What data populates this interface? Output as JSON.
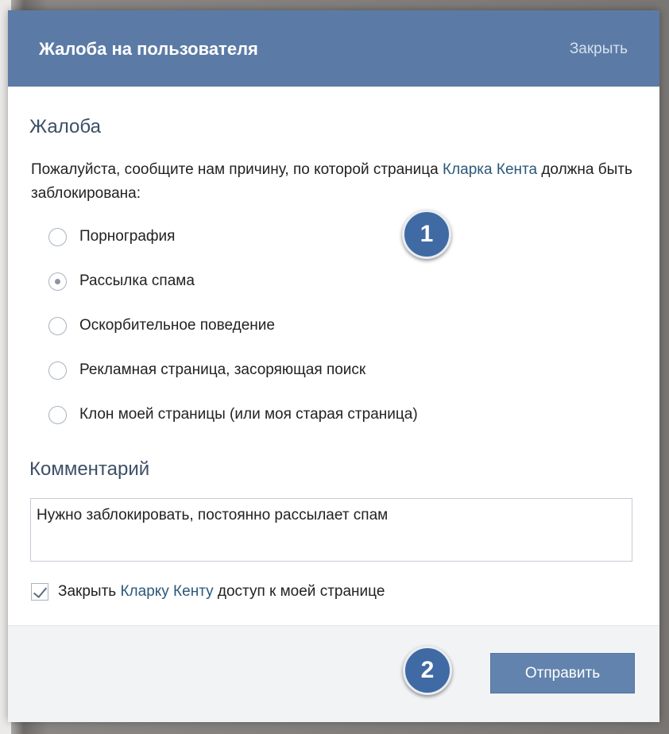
{
  "dialog": {
    "title": "Жалоба на пользователя",
    "close_label": "Закрыть"
  },
  "complaint": {
    "section_title": "Жалоба",
    "description_before": "Пожалуйста, сообщите нам причину, по которой страница ",
    "description_link": "Кларка Кента",
    "description_after": " должна быть заблокирована:",
    "options": [
      {
        "label": "Порнография",
        "checked": false
      },
      {
        "label": "Рассылка спама",
        "checked": true
      },
      {
        "label": "Оскорбительное поведение",
        "checked": false
      },
      {
        "label": "Рекламная страница, засоряющая поиск",
        "checked": false
      },
      {
        "label": "Клон моей страницы (или моя старая страница)",
        "checked": false
      }
    ]
  },
  "comment": {
    "section_title": "Комментарий",
    "value": "Нужно заблокировать, постоянно рассылает спам"
  },
  "block_access": {
    "checked": true,
    "label_before": "Закрыть ",
    "label_link": "Кларку Кенту",
    "label_after": " доступ к моей странице"
  },
  "submit_label": "Отправить",
  "badges": [
    "1",
    "2"
  ],
  "colors": {
    "header": "#5b7ba6",
    "button": "#6283ad",
    "badge": "#3f6aa3",
    "link": "#2b587a"
  }
}
